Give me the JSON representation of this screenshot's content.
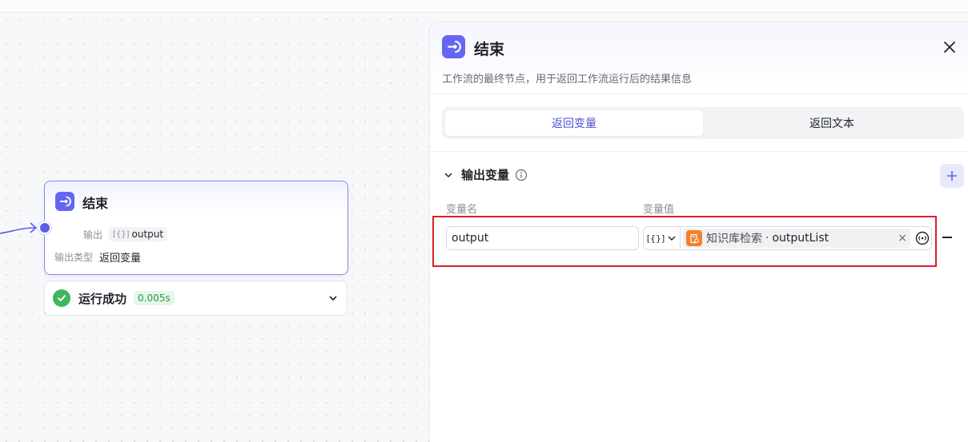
{
  "canvas": {
    "node": {
      "title": "结束",
      "output_label": "输出",
      "output_chip_type": "[{}]",
      "output_chip_name": "output",
      "output_type_label": "输出类型",
      "output_type_value": "返回变量"
    },
    "status": {
      "text": "运行成功",
      "time": "0.005s",
      "success_color": "#3eb55f"
    }
  },
  "panel": {
    "title": "结束",
    "description": "工作流的最终节点，用于返回工作流运行后的结果信息",
    "tabs": [
      {
        "label": "返回变量",
        "active": true
      },
      {
        "label": "返回文本",
        "active": false
      }
    ],
    "section": {
      "title": "输出变量",
      "col_name": "变量名",
      "col_value": "变量值",
      "rows": [
        {
          "name": "output",
          "type": "[{}]",
          "ref_source": "知识库检索",
          "ref_separator": "·",
          "ref_var": "outputList",
          "clear": "×"
        }
      ]
    },
    "accent_color": "#6466f1",
    "highlight_color": "#d8202a"
  }
}
